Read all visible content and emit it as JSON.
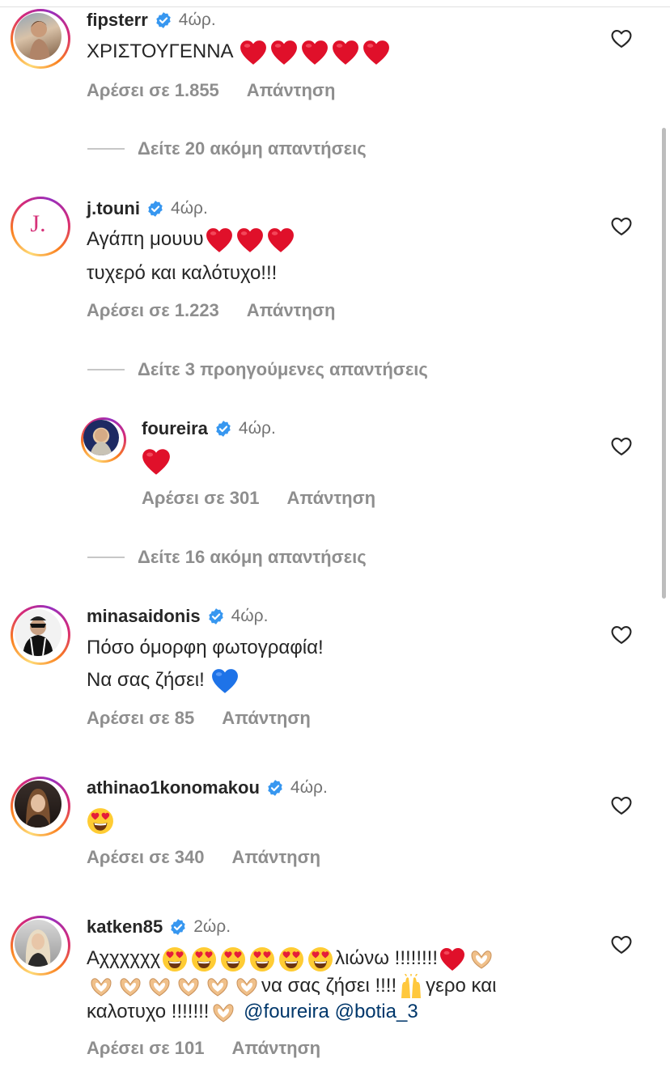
{
  "comments": [
    {
      "username": "fipsterr",
      "time": "4ώρ.",
      "text": "ΧΡΙΣΤΟΥΓΕΝΝΑ",
      "likes": "Αρέσει σε 1.855",
      "reply": "Απάντηση",
      "emoji_after": [
        "red-heart",
        "red-heart",
        "red-heart",
        "red-heart",
        "red-heart"
      ]
    },
    {
      "username": "j.touni",
      "time": "4ώρ.",
      "avatar_letter": "J.",
      "line1": "Αγάπη μουυυ",
      "line2": "τυχερό και καλότυχο!!!",
      "likes": "Αρέσει σε 1.223",
      "reply": "Απάντηση",
      "emoji_after": [
        "red-heart",
        "red-heart",
        "red-heart"
      ]
    },
    {
      "username": "foureira",
      "time": "4ώρ.",
      "likes": "Αρέσει σε 301",
      "reply": "Απάντηση",
      "emoji": [
        "red-heart"
      ]
    },
    {
      "username": "minasaidonis",
      "time": "4ώρ.",
      "line1": "Πόσο όμορφη φωτογραφία!",
      "line2": "Να σας ζήσει!",
      "likes": "Αρέσει σε 85",
      "reply": "Απάντηση",
      "emoji_after": [
        "blue-heart"
      ]
    },
    {
      "username": "athinao1konomakou",
      "time": "4ώρ.",
      "likes": "Αρέσει σε 340",
      "reply": "Απάντηση",
      "emoji": [
        "heart-eyes-face"
      ]
    },
    {
      "username": "katken85",
      "time": "2ώρ.",
      "line1_start": "Αχχχχχχ",
      "line1_word": "λιώνω !!!!!!!!",
      "line2_text": "να σας ζήσει !!!!",
      "line2_end": "γερο και",
      "line3_text": "καλοτυχο !!!!!!!",
      "mention1": "@foureira",
      "mention2": "@botia_3",
      "likes": "Αρέσει σε 101",
      "reply": "Απάντηση"
    }
  ],
  "view_replies": [
    "Δείτε 20 ακόμη απαντήσεις",
    "Δείτε 3 προηγούμενες απαντήσεις",
    "Δείτε 16 ακόμη απαντήσεις"
  ],
  "colors": {
    "verified": "#3797f0",
    "link": "#00376b",
    "muted": "#8e8e8e",
    "heart_red": "#e0102a",
    "heart_blue": "#1e73e8"
  }
}
